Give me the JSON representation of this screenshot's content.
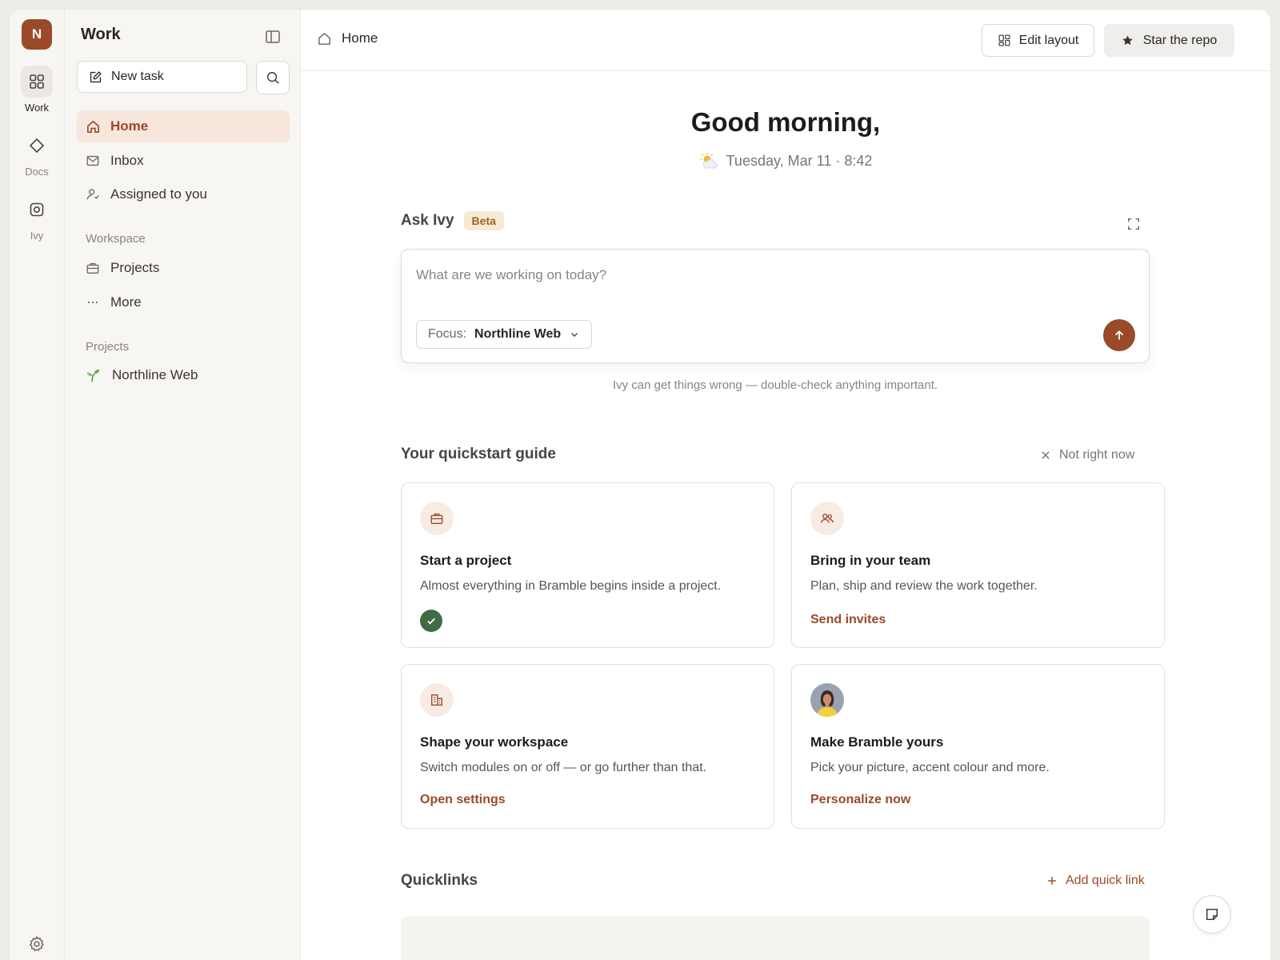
{
  "rail": {
    "avatar_initial": "N",
    "items": [
      {
        "label": "Work",
        "icon": "grid-icon"
      },
      {
        "label": "Docs",
        "icon": "diamond-icon"
      },
      {
        "label": "Ivy",
        "icon": "ivy-icon"
      }
    ],
    "settings_icon": "gear-icon"
  },
  "sidebar": {
    "title": "Work",
    "new_task_label": "New task",
    "nav": [
      {
        "label": "Home",
        "icon": "home-icon",
        "active": true
      },
      {
        "label": "Inbox",
        "icon": "inbox-icon"
      },
      {
        "label": "Assigned to you",
        "icon": "user-icon"
      }
    ],
    "workspace_section": "Workspace",
    "workspace_items": [
      {
        "label": "Projects",
        "icon": "briefcase-icon"
      },
      {
        "label": "More",
        "icon": "more-icon"
      }
    ],
    "projects_section": "Projects",
    "projects": [
      {
        "label": "Northline Web",
        "icon": "sprout-icon"
      }
    ]
  },
  "topbar": {
    "breadcrumb": "Home",
    "edit_layout_label": "Edit layout",
    "star_repo_label": "Star the repo"
  },
  "greeting": {
    "title": "Good morning,",
    "date": "Tuesday, Mar 11 · 8:42"
  },
  "ask": {
    "title": "Ask Ivy",
    "badge": "Beta",
    "placeholder": "What are we working on today?",
    "focus_key": "Focus:",
    "focus_value": "Northline Web",
    "disclaimer": "Ivy can get things wrong — double-check anything important."
  },
  "quickstart": {
    "title": "Your quickstart guide",
    "dismiss_label": "Not right now",
    "cards": [
      {
        "title": "Start a project",
        "desc": "Almost everything in Bramble begins inside a project.",
        "icon": "briefcase-icon",
        "completed": true
      },
      {
        "title": "Bring in your team",
        "desc": "Plan, ship and review the work together.",
        "link": "Send invites",
        "icon": "team-icon"
      },
      {
        "title": "Shape your workspace",
        "desc": "Switch modules on or off — or go further than that.",
        "link": "Open settings",
        "icon": "building-icon"
      },
      {
        "title": "Make Bramble yours",
        "desc": "Pick your picture, accent colour and more.",
        "link": "Personalize now",
        "icon": "avatar-photo"
      }
    ]
  },
  "quicklinks": {
    "title": "Quicklinks",
    "add_label": "Add quick link"
  },
  "colors": {
    "accent": "#9a4a28",
    "active_bg": "#f7e6dc",
    "success": "#3f6b45"
  }
}
